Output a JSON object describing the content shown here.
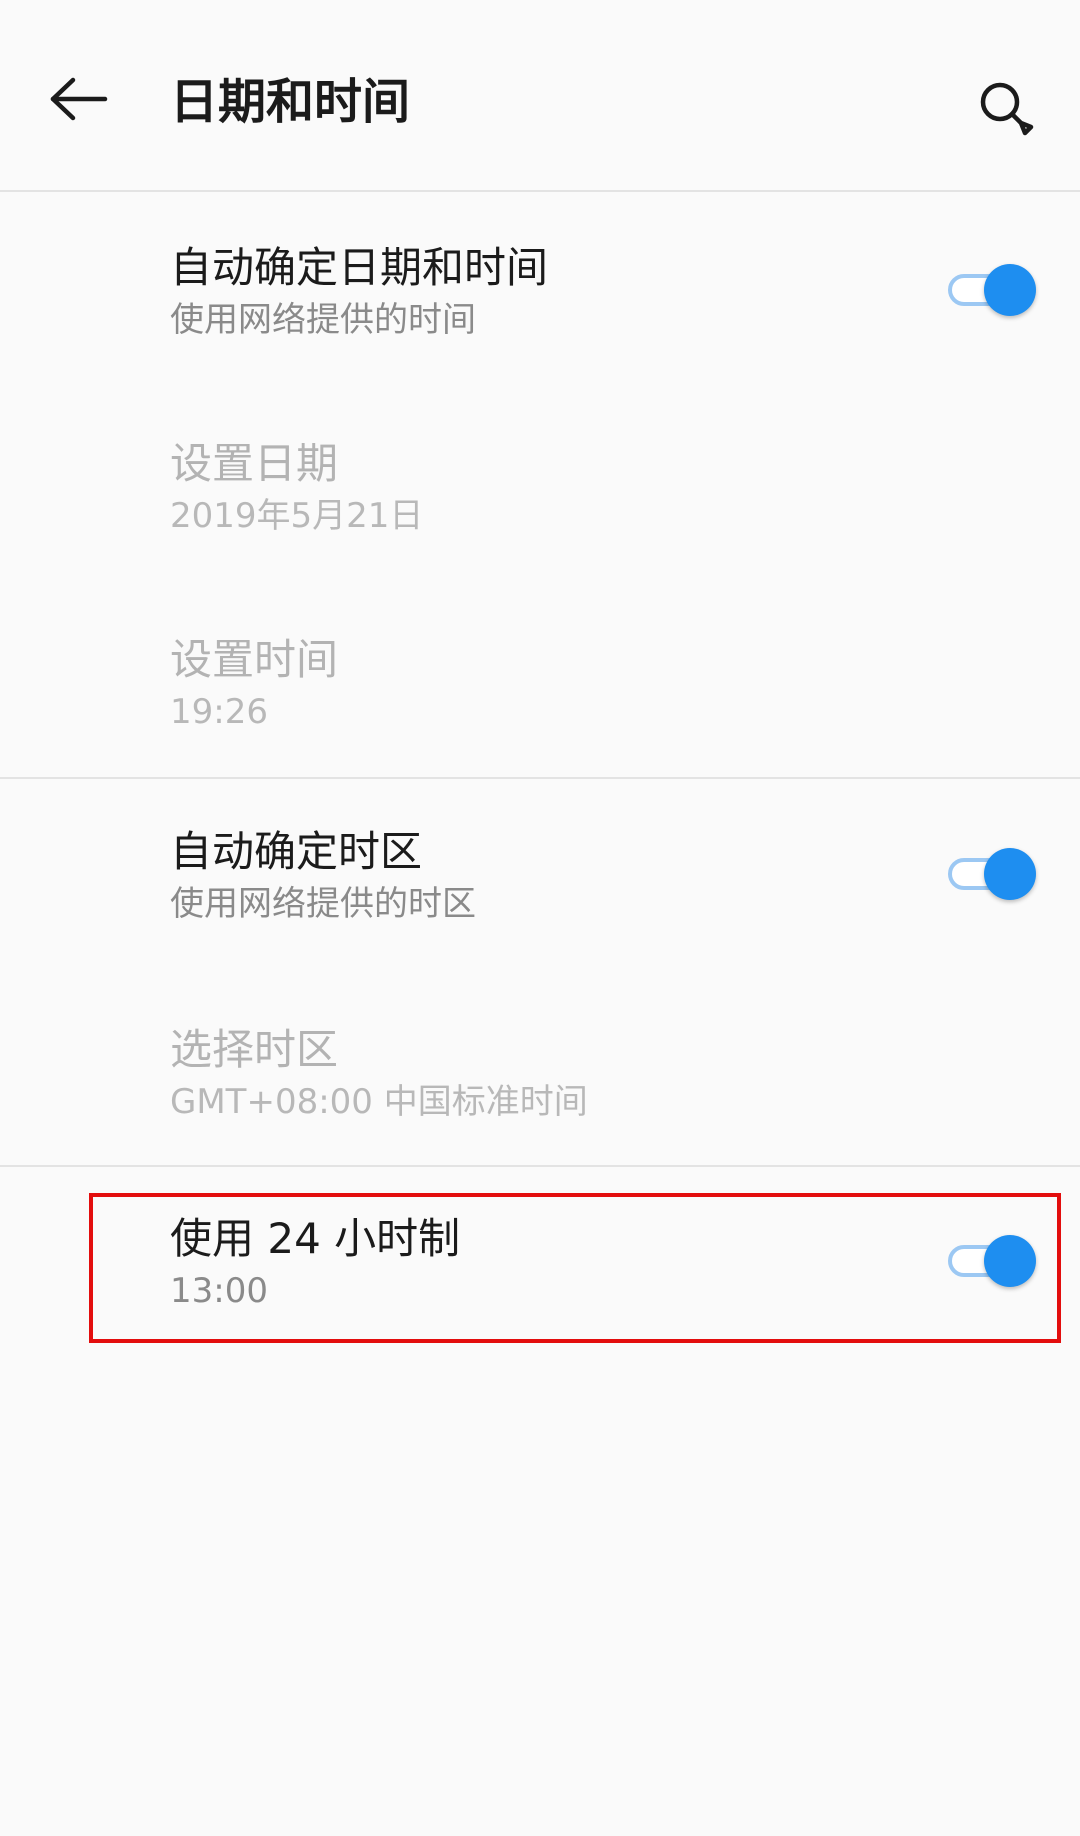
{
  "header": {
    "title": "日期和时间",
    "back_icon": "arrow-left-icon",
    "search_icon": "search-icon"
  },
  "settings": [
    {
      "title": "自动确定日期和时间",
      "subtitle": "使用网络提供的时间",
      "toggle": true,
      "enabled": true
    },
    {
      "title": "设置日期",
      "subtitle": "2019年5月21日",
      "enabled": false
    },
    {
      "title": "设置时间",
      "subtitle": "19:26",
      "enabled": false
    },
    {
      "title": "自动确定时区",
      "subtitle": "使用网络提供的时区",
      "toggle": true,
      "enabled": true
    },
    {
      "title": "选择时区",
      "subtitle": "GMT+08:00 中国标准时间",
      "enabled": false
    },
    {
      "title": "使用 24 小时制",
      "subtitle": "13:00",
      "toggle": true,
      "enabled": true
    }
  ],
  "colors": {
    "accent": "#1e8ef0",
    "track": "#9cc8f3",
    "highlight": "#e30d0d"
  }
}
